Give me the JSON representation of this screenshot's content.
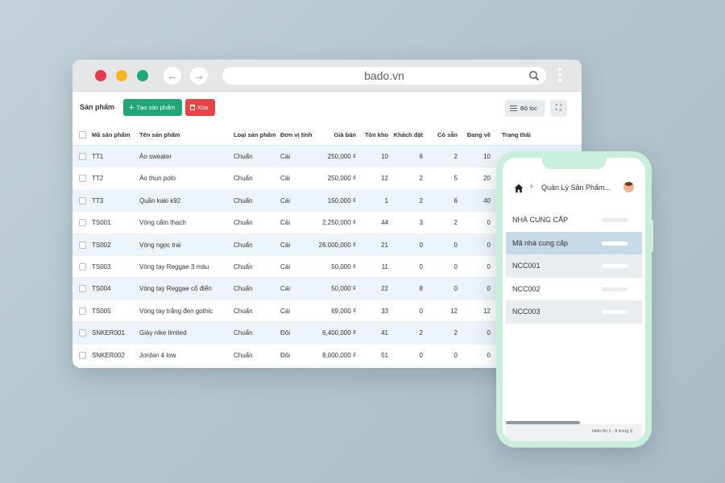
{
  "browser": {
    "url": "bado.vn",
    "icons": {
      "back": "arrow-left-icon",
      "forward": "arrow-right-icon",
      "search": "search-icon",
      "menu": "more-vertical-icon"
    }
  },
  "toolbar": {
    "title": "Sản phẩm",
    "create_label": "Tạo sản phẩm",
    "delete_label": "Xóa",
    "filter_label": "Bộ lọc"
  },
  "table": {
    "headers": {
      "code": "Mã sản phẩm",
      "name": "Tên sản phẩm",
      "type": "Loại sản phẩm",
      "unit": "Đơn vị tính",
      "price": "Giá bán",
      "stock": "Tồn kho",
      "ordered": "Khách đặt",
      "available": "Có sẵn",
      "incoming": "Đang về",
      "status": "Trạng thái"
    },
    "rows": [
      {
        "code": "TT1",
        "name": "Áo sweater",
        "type": "Chuẩn",
        "unit": "Cái",
        "price": "250,000 ₫",
        "stock": "10",
        "ordered": "6",
        "available": "2",
        "incoming": "10"
      },
      {
        "code": "TT2",
        "name": "Áo thun polo",
        "type": "Chuẩn",
        "unit": "Cái",
        "price": "250,000 ₫",
        "stock": "12",
        "ordered": "2",
        "available": "5",
        "incoming": "20"
      },
      {
        "code": "TT3",
        "name": "Quần kaki k92",
        "type": "Chuẩn",
        "unit": "Cái",
        "price": "150,000 ₫",
        "stock": "1",
        "ordered": "2",
        "available": "6",
        "incoming": "40"
      },
      {
        "code": "TS001",
        "name": "Vòng cẩm thạch",
        "type": "Chuẩn",
        "unit": "Cái",
        "price": "2,250,000 ₫",
        "stock": "44",
        "ordered": "3",
        "available": "2",
        "incoming": "0"
      },
      {
        "code": "TS002",
        "name": "Vòng ngọc trai",
        "type": "Chuẩn",
        "unit": "Cái",
        "price": "26.000,000 ₫",
        "stock": "21",
        "ordered": "0",
        "available": "0",
        "incoming": "0"
      },
      {
        "code": "TS003",
        "name": "Vòng tay Reggae 3 màu",
        "type": "Chuẩn",
        "unit": "Cái",
        "price": "50,000 ₫",
        "stock": "11",
        "ordered": "0",
        "available": "0",
        "incoming": "0"
      },
      {
        "code": "TS004",
        "name": "Vòng tay Reggae cổ điển",
        "type": "Chuẩn",
        "unit": "Cái",
        "price": "50,000 ₫",
        "stock": "22",
        "ordered": "8",
        "available": "0",
        "incoming": "0"
      },
      {
        "code": "TS005",
        "name": "Vòng tay trắng đen gothic",
        "type": "Chuẩn",
        "unit": "Cái",
        "price": "69,000 ₫",
        "stock": "33",
        "ordered": "0",
        "available": "12",
        "incoming": "12"
      },
      {
        "code": "SNKER001",
        "name": "Giày nike limited",
        "type": "Chuẩn",
        "unit": "Đôi",
        "price": "6,400,000 ₫",
        "stock": "41",
        "ordered": "2",
        "available": "2",
        "incoming": "0"
      },
      {
        "code": "SNKER002",
        "name": "Jordan 4 low",
        "type": "Chuẩn",
        "unit": "Đôi",
        "price": "8,000,000 ₫",
        "stock": "51",
        "ordered": "0",
        "available": "0",
        "incoming": "0"
      }
    ]
  },
  "phone": {
    "title": "Quản Lý Sản Phẩm...",
    "list": [
      "NHÀ CUNG CẤP",
      "Mã nhà cung cấp",
      "NCC001",
      "NCC002",
      "NCC003"
    ],
    "footer": "Hiển thị 1 - 9 trong 9"
  },
  "colors": {
    "primary": "#22a678",
    "danger": "#e74545",
    "stripe": "#edf3fa",
    "phone_frame": "#c9eedb"
  }
}
